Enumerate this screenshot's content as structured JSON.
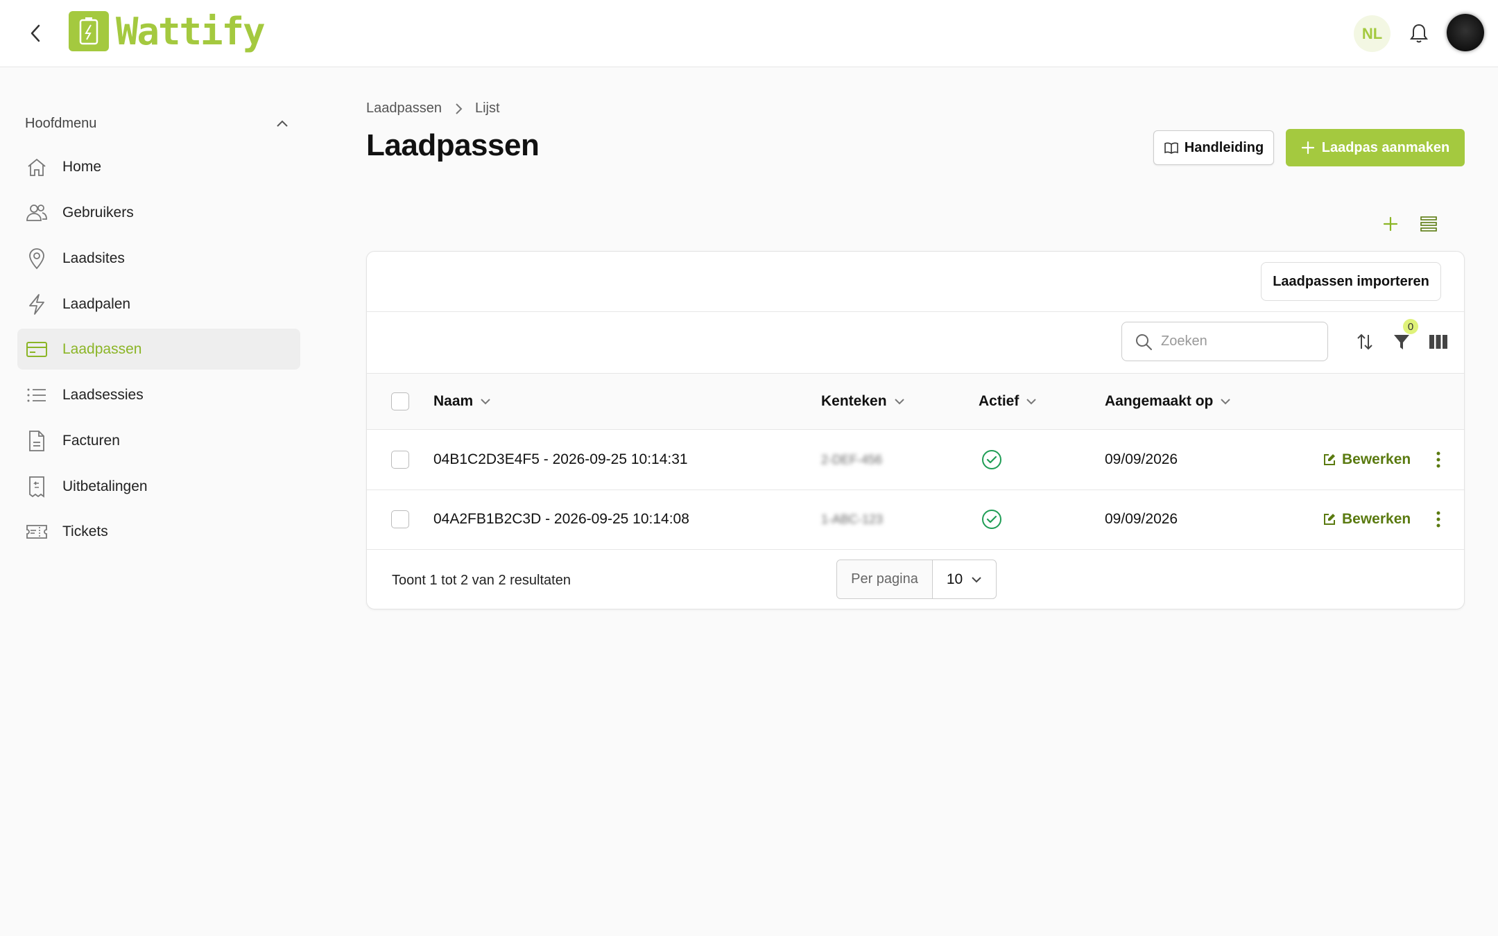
{
  "app": {
    "logo_text": "Wattify",
    "brand_color": "#a4c93f"
  },
  "header": {
    "language": "NL",
    "icons": [
      "chevron-left-icon",
      "bell-icon",
      "avatar"
    ]
  },
  "sidebar": {
    "menu_title": "Hoofdmenu",
    "items": [
      {
        "label": "Home",
        "icon": "home-icon"
      },
      {
        "label": "Gebruikers",
        "icon": "users-icon"
      },
      {
        "label": "Laadsites",
        "icon": "location-pin-icon"
      },
      {
        "label": "Laadpalen",
        "icon": "lightning-icon"
      },
      {
        "label": "Laadpassen",
        "icon": "card-icon",
        "active": true
      },
      {
        "label": "Laadsessies",
        "icon": "list-icon"
      },
      {
        "label": "Facturen",
        "icon": "document-icon"
      },
      {
        "label": "Uitbetalingen",
        "icon": "receipt-icon"
      },
      {
        "label": "Tickets",
        "icon": "ticket-icon"
      }
    ]
  },
  "breadcrumb": {
    "parent": "Laadpassen",
    "current": "Lijst"
  },
  "page": {
    "title": "Laadpassen",
    "manual_button": "Handleiding",
    "create_button": "Laadpas aanmaken",
    "import_button": "Laadpassen importeren"
  },
  "toolbar": {
    "search_placeholder": "Zoeken",
    "filter_count": "0"
  },
  "table": {
    "columns": [
      "Naam",
      "Kenteken",
      "Actief",
      "Aangemaakt op"
    ],
    "rows": [
      {
        "naam": "04B1C2D3E4F5 - 2026-09-25 10:14:31",
        "kenteken": "2-DEF-456",
        "actief": true,
        "aangemaakt_op": "09/09/2026",
        "edit": "Bewerken"
      },
      {
        "naam": "04A2FB1B2C3D - 2026-09-25 10:14:08",
        "kenteken": "1-ABC-123",
        "actief": true,
        "aangemaakt_op": "09/09/2026",
        "edit": "Bewerken"
      }
    ]
  },
  "pagination": {
    "summary": "Toont 1 tot 2 van 2 resultaten",
    "per_page_label": "Per pagina",
    "per_page_value": "10"
  }
}
